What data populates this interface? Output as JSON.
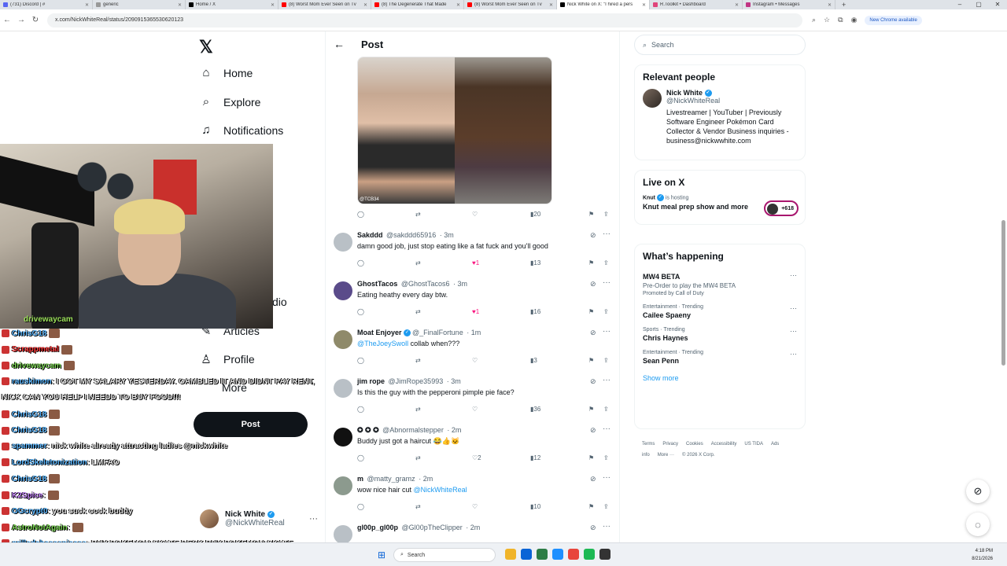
{
  "browser": {
    "tabs": [
      {
        "label": "(731) Discord | #",
        "color": "#5865f2"
      },
      {
        "label": "generic",
        "color": "#999999"
      },
      {
        "label": "Home / X",
        "color": "#000000"
      },
      {
        "label": "(8) Worst Mom Ever Seen on Tv",
        "color": "#ff0000"
      },
      {
        "label": "(8) The Degenerate That Made",
        "color": "#ff0000"
      },
      {
        "label": "(8) Worst Mom Ever Seen on Tv",
        "color": "#ff0000"
      },
      {
        "label": "Nick White on X: \"I hired a pers",
        "color": "#000000",
        "active": true
      },
      {
        "label": "R.Toolkit • Dashboard",
        "color": "#e0457b"
      },
      {
        "label": "Instagram • Messages",
        "color": "#c13584"
      }
    ],
    "url": "x.com/NickWhiteReal/status/2090915365530620123",
    "chrome_button": "New Chrome available"
  },
  "nav": {
    "items": [
      {
        "label": "Home",
        "icon": "home-icon",
        "glyph": "⌂"
      },
      {
        "label": "Explore",
        "icon": "search-icon",
        "glyph": "⌕"
      },
      {
        "label": "Notifications",
        "icon": "bell-icon",
        "glyph": "🔔"
      },
      {
        "label": "dio",
        "icon": "",
        "glyph": ""
      },
      {
        "label": "Articles",
        "icon": "articles-icon",
        "glyph": "✎"
      },
      {
        "label": "Profile",
        "icon": "person-icon",
        "glyph": "👤"
      },
      {
        "label": "More",
        "icon": "more-icon",
        "glyph": "⋯"
      }
    ],
    "post_button": "Post",
    "account": {
      "name": "Nick White",
      "handle": "@NickWhiteReal"
    }
  },
  "webcam": {
    "label": "drivewaycam"
  },
  "chat": [
    {
      "user": "ChrisG18",
      "msg": "",
      "color": "#5db8ff"
    },
    {
      "user": "Scrappmetal",
      "msg": "",
      "color": "#ff3b3b"
    },
    {
      "user": "drivewaycam",
      "msg": "",
      "color": "#7ed957"
    },
    {
      "user": "rauskimon",
      "msg": ": I GOT MY SALARY YESTERDAY. GAMBLED IT AND DIDNT PAY RENT,",
      "color": "#5db8ff"
    },
    {
      "user": "",
      "msg": "NICK CAN YOU HELP I NEEDD TO BUY FOOD!!!",
      "color": "#e6e6e6"
    },
    {
      "user": "ChrisG18",
      "msg": "",
      "color": "#5db8ff"
    },
    {
      "user": "ChrisG18",
      "msg": "",
      "color": "#5db8ff"
    },
    {
      "user": "spammer",
      "msg": ": nick white already attracting ladies @nickwhite",
      "color": "#5db8ff"
    },
    {
      "user": "LordSkeletonization",
      "msg": ": LMFAO",
      "color": "#5db8ff"
    },
    {
      "user": "ChrisG18",
      "msg": "",
      "color": "#5db8ff"
    },
    {
      "user": "K2Spice",
      "msg": ":",
      "color": "#c98bff"
    },
    {
      "user": "OGcrypt0",
      "msg": ": you suck cock buddy",
      "color": "#5db8ff"
    },
    {
      "user": "AstroNotAgain",
      "msg": ":",
      "color": "#7ed957"
    },
    {
      "user": "grilledcheesepiease",
      "msg": ": BUY POKEMON SKATE DECK   BUY POKEMON SKATE",
      "color": "#5db8ff"
    },
    {
      "user": "",
      "msg": "DECK   BUY POKEMON SKATE",
      "color": "#e6e6e6"
    }
  ],
  "main": {
    "title": "Post",
    "media_watermark": "@TCB34",
    "post_actions": {
      "replies": "",
      "reposts": "",
      "likes": "",
      "views": "20"
    },
    "replies": [
      {
        "name": "Sakddd",
        "handle": "@sakddd65916",
        "time": "· 3m",
        "verified": false,
        "text": "damn good job, just stop eating like a fat fuck and you'll good",
        "likes": "1",
        "liked": true,
        "views": "13",
        "avatar": "#b9c0c6"
      },
      {
        "name": "GhostTacos",
        "handle": "@GhostTacos6",
        "time": "· 3m",
        "verified": false,
        "text": "Eating heathy every day btw.",
        "likes": "1",
        "liked": true,
        "views": "16",
        "avatar": "#5a4b8a"
      },
      {
        "name": "Moat Enjoyer",
        "handle": "@_FinalFortune",
        "time": "· 1m",
        "verified": true,
        "mention": "@TheJoeySwoll",
        "text": " collab when???",
        "likes": "",
        "liked": false,
        "views": "3",
        "avatar": "#8f8a6a"
      },
      {
        "name": "jim rope",
        "handle": "@JimRope35993",
        "time": "· 3m",
        "verified": false,
        "text": "Is this the guy with the pepperoni pimple pie face?",
        "likes": "",
        "liked": false,
        "views": "36",
        "avatar": "#b9c0c6"
      },
      {
        "name": "✪ ✪ ✪",
        "handle": "@Abnormalstepper",
        "time": "· 2m",
        "verified": false,
        "text": "Buddy just got a haircut 😂👍🐱",
        "likes": "2",
        "liked": false,
        "views": "12",
        "avatar": "#111111"
      },
      {
        "name": "m",
        "handle": "@matty_gramz",
        "time": "· 2m",
        "verified": false,
        "text": "wow nice hair cut ",
        "mention_after": "@NickWhiteReal",
        "likes": "",
        "liked": false,
        "views": "10",
        "avatar": "#8c9a8e"
      },
      {
        "name": "gl00p_gl00p",
        "handle": "@Gl00pTheClipper",
        "time": "· 2m",
        "verified": false,
        "text": "",
        "likes": "",
        "liked": false,
        "views": "",
        "avatar": "#b9c0c6"
      }
    ]
  },
  "right": {
    "search_placeholder": "Search",
    "relevant_people": {
      "title": "Relevant people",
      "name": "Nick White",
      "handle": "@NickWhiteReal",
      "bio": "Livestreamer | YouTuber | Previously Software Engineer Pokémon Card Collector & Vendor Business inquiries - business@nickwwhite.com"
    },
    "live": {
      "title": "Live on X",
      "host": "Knut",
      "hosting": "is hosting",
      "show": "Knut meal prep show and more",
      "count": "+618"
    },
    "happening": {
      "title": "What’s happening",
      "items": [
        {
          "meta": "",
          "name": "MW4 BETA",
          "sub": "Pre-Order to play the MW4 BETA",
          "promo": "Promoted by Call of Duty"
        },
        {
          "meta": "Entertainment · Trending",
          "name": "Cailee Spaeny",
          "sub": "",
          "promo": ""
        },
        {
          "meta": "Sports · Trending",
          "name": "Chris Haynes",
          "sub": "",
          "promo": ""
        },
        {
          "meta": "Entertainment · Trending",
          "name": "Sean Penn",
          "sub": "",
          "promo": ""
        }
      ],
      "show_more": "Show more"
    },
    "footer": [
      "Terms",
      "Privacy",
      "Cookies",
      "Accessibility",
      "US TIDA",
      "Ads info",
      "More ···",
      "© 2026 X Corp."
    ]
  },
  "taskbar": {
    "search": "Search",
    "time": "4:18 PM",
    "date": "8/21/2026"
  }
}
